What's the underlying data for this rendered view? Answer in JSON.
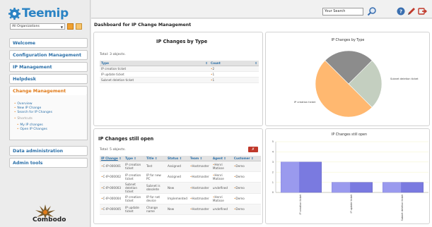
{
  "app": {
    "logo_text": "Teemip",
    "bottom_logo_text": "Combodo"
  },
  "org": {
    "selected": "All Organizations"
  },
  "menu": {
    "welcome": "Welcome",
    "config": "Configuration Management",
    "ip": "IP Management",
    "helpdesk": "Helpdesk",
    "change": "Change Management",
    "data_admin": "Data administration",
    "admin_tools": "Admin tools"
  },
  "submenu": {
    "overview": "Overview",
    "new_change": "New IP Change",
    "search": "Search for IP Changes",
    "shortcuts": "Shortcuts",
    "my_changes": "My IP changes",
    "open_changes": "Open IP Changes"
  },
  "search": {
    "placeholder": "Your Search"
  },
  "page": {
    "title": "Dashboard for IP Change Management"
  },
  "by_type": {
    "title": "IP Changes by Type",
    "total": "Total: 3 objects.",
    "col_type": "Type",
    "col_count": "Count",
    "rows": [
      {
        "type": "IP creation ticket",
        "count": "2"
      },
      {
        "type": "IP update ticket",
        "count": "1"
      },
      {
        "type": "Subnet deletion ticket",
        "count": "1"
      }
    ]
  },
  "still_open": {
    "title": "IP Changes still open",
    "total": "Total: 5 objects.",
    "cols": {
      "change": "IP Change",
      "type": "Type",
      "title": "Title",
      "status": "Status",
      "team": "Team",
      "agent": "Agent",
      "customer": "Customer"
    },
    "rows": [
      {
        "change": "C-IP-000001",
        "type": "IP creation ticket",
        "title": "Test",
        "status": "Assigned",
        "team": "Hostmaster",
        "agent": "Henri Matisse",
        "customer": "Demo"
      },
      {
        "change": "C-IP-000002",
        "type": "IP creation ticket",
        "title": "IP for new PC",
        "status": "Assigned",
        "team": "Hostmaster",
        "agent": "Henri Matisse",
        "customer": "Demo"
      },
      {
        "change": "C-IP-000003",
        "type": "Subnet deletion ticket",
        "title": "Subnet is obsolete",
        "status": "New",
        "team": "Hostmaster",
        "agent": "undefined",
        "customer": "Demo"
      },
      {
        "change": "C-IP-000004",
        "type": "IP creation ticket",
        "title": "IP for net device",
        "status": "Implemented",
        "team": "Hostmaster",
        "agent": "Henri Matisse",
        "customer": "Demo"
      },
      {
        "change": "C-IP-000005",
        "type": "IP update ticket",
        "title": "Change name",
        "status": "New",
        "team": "Hostmaster",
        "agent": "undefined",
        "customer": "Demo"
      }
    ]
  },
  "chart_data": [
    {
      "type": "pie",
      "title": "IP Changes by Type",
      "categories": [
        "IP creation ticket",
        "IP update ticket",
        "Subnet deletion ticket"
      ],
      "values": [
        2,
        1,
        1
      ],
      "colors": [
        "#ffb870",
        "#c4cfc0",
        "#8c8c8c"
      ]
    },
    {
      "type": "bar",
      "title": "IP Changes still open",
      "categories": [
        "IP creation ticket",
        "IP update ticket",
        "Subnet deletion ticket"
      ],
      "values": [
        3,
        1,
        1
      ],
      "ylim": [
        0,
        5
      ],
      "yticks": [
        0,
        1,
        2,
        3,
        4,
        5
      ],
      "color": "#7a7ae0"
    }
  ]
}
